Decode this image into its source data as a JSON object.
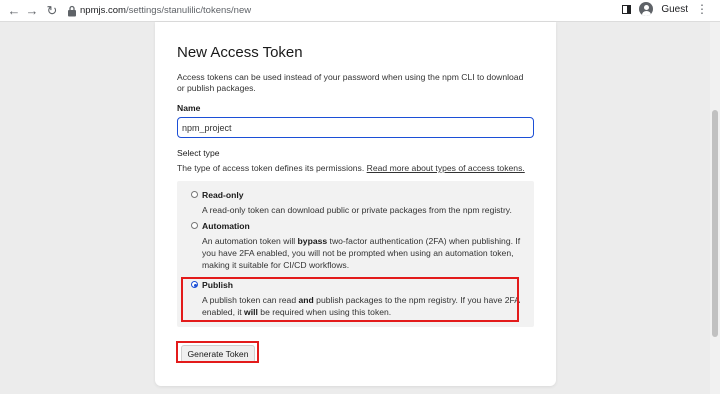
{
  "browser": {
    "url_domain": "npmjs.com",
    "url_path": "/settings/stanulilic/tokens/new",
    "profile_label": "Guest",
    "icons": [
      "back-arrow-icon",
      "forward-arrow-icon",
      "lock-icon",
      "side-panel-icon",
      "avatar-icon",
      "kebab-menu-icon"
    ]
  },
  "form": {
    "title": "New Access Token",
    "description": "Access tokens can be used instead of your password when using the npm CLI to download or publish packages.",
    "name_label": "Name",
    "name_value": "npm_project",
    "select_type_label": "Select type",
    "type_description": "The type of access token defines its permissions.",
    "type_link": "Read more about types of access tokens.",
    "options": [
      {
        "title": "Read-only",
        "desc": "A read-only token can download public or private packages from the npm registry.",
        "checked": false
      },
      {
        "title": "Automation",
        "desc_pre": "An automation token will ",
        "desc_bold": "bypass",
        "desc_post": " two-factor authentication (2FA) when publishing. If you have 2FA enabled, you will not be prompted when using an automation token, making it suitable for CI/CD workflows.",
        "checked": false
      },
      {
        "title": "Publish",
        "desc_pre": "A publish token can read ",
        "desc_bold": "and",
        "desc_mid": " publish packages to the npm registry. If you have 2FA enabled, it ",
        "desc_bold2": "will",
        "desc_post": " be required when using this token.",
        "checked": true
      }
    ],
    "generate_button": "Generate Token"
  },
  "colors": {
    "accent": "#1c4fd6",
    "highlight": "#e31b1b",
    "background": "#ececec",
    "card": "#ffffff",
    "options_bg": "#f2f2f2"
  }
}
